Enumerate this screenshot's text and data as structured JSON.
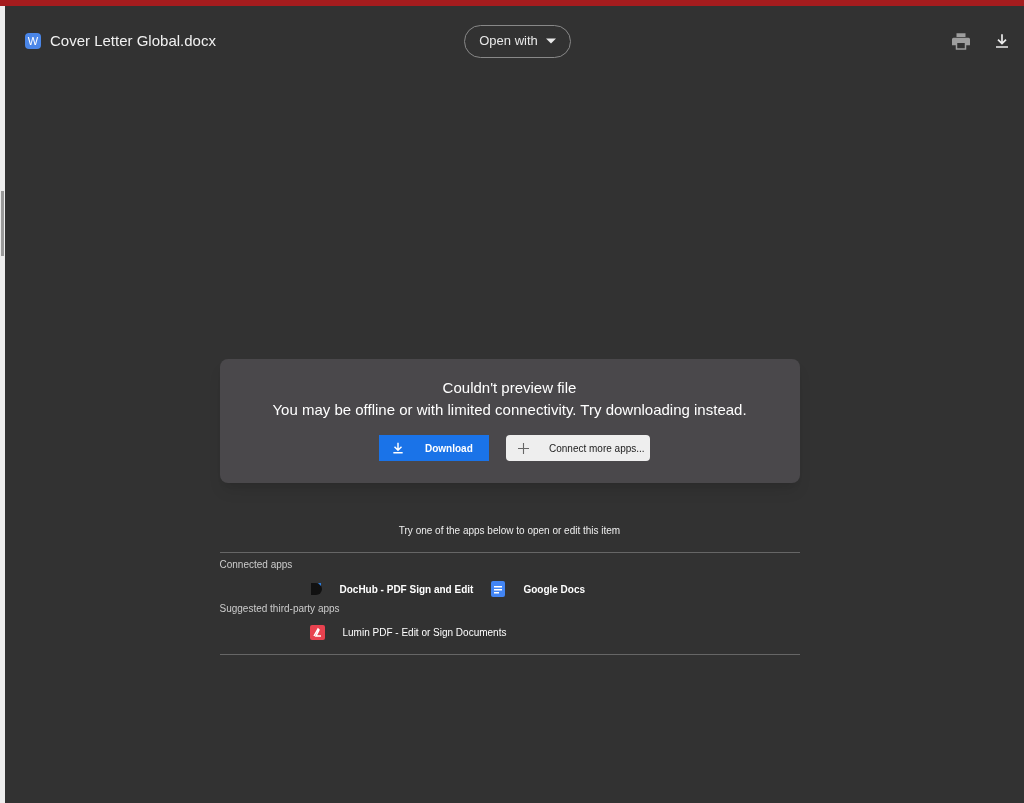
{
  "header": {
    "file_name": "Cover Letter Global.docx",
    "file_badge": "W",
    "open_with": "Open with"
  },
  "dialog": {
    "title": "Couldn't preview file",
    "message": "You may be offline or with limited connectivity. Try downloading instead.",
    "buttons": [
      {
        "kind": "primary",
        "label": "Download"
      },
      {
        "kind": "secondary",
        "label": "Connect more apps..."
      }
    ]
  },
  "apps": {
    "hint": "Try one of the apps below to open or edit this item",
    "sections": [
      {
        "kind": "connected",
        "title": "Connected apps",
        "items": [
          {
            "kind": "dochub",
            "name": "DocHub - PDF Sign and Edit"
          },
          {
            "kind": "docs",
            "name": "Google Docs"
          }
        ]
      },
      {
        "kind": "suggested",
        "title": "Suggested third-party apps",
        "items": [
          {
            "kind": "lumin",
            "name": "Lumin PDF - Edit or Sign Documents"
          }
        ]
      }
    ]
  }
}
